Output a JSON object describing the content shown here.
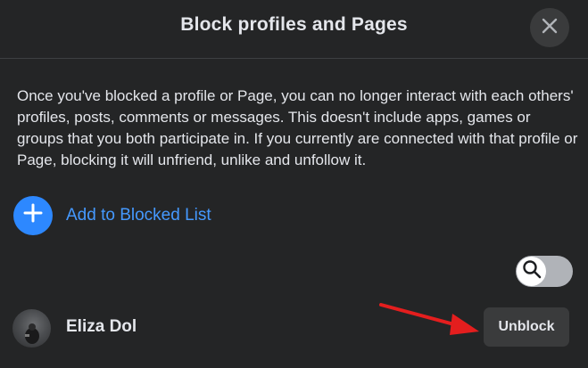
{
  "dialog": {
    "title": "Block profiles and Pages",
    "close_icon": "close-icon",
    "description": "Once you've blocked a profile or Page, you can no longer interact with each others' profiles, posts, comments or messages. This doesn't include apps, games or groups that you both participate in. If you currently are connected with that profile or Page, blocking it will unfriend, unlike and unfollow it."
  },
  "add_blocked": {
    "label": "Add to Blocked List",
    "icon": "plus-icon"
  },
  "search_toggle": {
    "icon": "search-icon"
  },
  "blocked_list": [
    {
      "name": "Eliza Dol",
      "action_label": "Unblock"
    }
  ],
  "colors": {
    "background": "#242526",
    "accent": "#2d88ff",
    "link": "#4599ff",
    "annotation_arrow": "#e41e1e"
  }
}
